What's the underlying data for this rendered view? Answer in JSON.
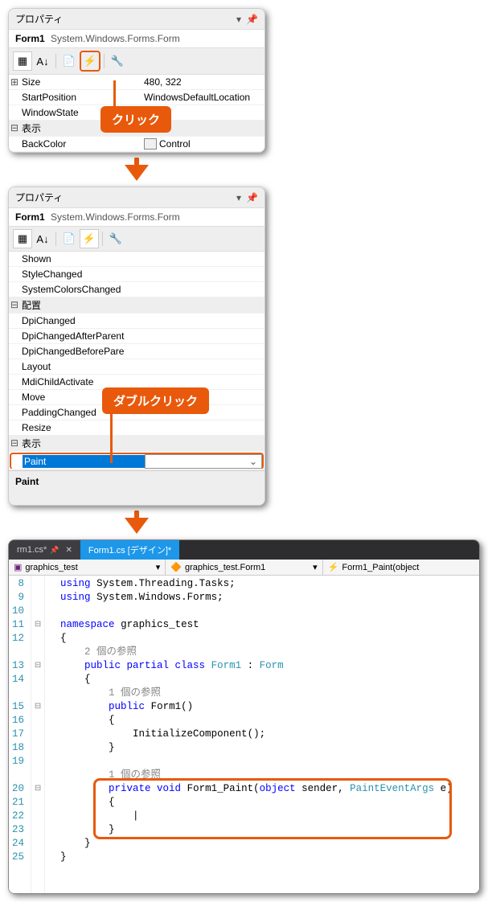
{
  "panel1": {
    "title": "プロパティ",
    "selector_name": "Form1",
    "selector_type": "System.Windows.Forms.Form",
    "rows": [
      {
        "exp": "⊞",
        "name": "Size",
        "val": "480, 322"
      },
      {
        "exp": "",
        "name": "StartPosition",
        "val": "WindowsDefaultLocation"
      },
      {
        "exp": "",
        "name": "WindowState",
        "val": ""
      }
    ],
    "cat": "表示",
    "backcolor_label": "BackColor",
    "backcolor_value": "Control"
  },
  "callout1": "クリック",
  "panel2": {
    "title": "プロパティ",
    "selector_name": "Form1",
    "selector_type": "System.Windows.Forms.Form",
    "events_misc": [
      "Shown",
      "StyleChanged",
      "SystemColorsChanged"
    ],
    "cat1": "配置",
    "events_layout": [
      "DpiChanged",
      "DpiChangedAfterParent",
      "DpiChangedBeforePare",
      "Layout",
      "MdiChildActivate",
      "Move",
      "PaddingChanged",
      "Resize"
    ],
    "cat2": "表示",
    "selected": "Paint",
    "desc": "Paint"
  },
  "callout2": "ダブルクリック",
  "tabs": {
    "t1": "rm1.cs*",
    "t2": "Form1.cs [デザイン]*"
  },
  "nav": {
    "seg1": "graphics_test",
    "seg2": "graphics_test.Form1",
    "seg3": "Form1_Paint(object"
  },
  "code": {
    "lines": [
      8,
      9,
      10,
      11,
      12,
      13,
      14,
      15,
      16,
      17,
      18,
      19,
      20,
      21,
      22,
      23,
      24,
      25
    ],
    "ref1": "2 個の参照",
    "ref2": "1 個の参照",
    "ref3": "1 個の参照",
    "l8_a": "using",
    "l8_b": "System.Threading.Tasks;",
    "l9_a": "using",
    "l9_b": "System.Windows.Forms;",
    "l11_a": "namespace",
    "l11_b": "graphics_test",
    "l12": "{",
    "l13_a": "public partial class",
    "l13_b": "Form1",
    "l13_c": " : ",
    "l13_d": "Form",
    "l14": "{",
    "l15_a": "public",
    "l15_b": "Form1()",
    "l16": "{",
    "l17": "InitializeComponent();",
    "l18": "}",
    "l20_a": "private void",
    "l20_b": "Form1_Paint(",
    "l20_c": "object",
    "l20_d": " sender, ",
    "l20_e": "PaintEventArgs",
    "l20_f": " e)",
    "l21": "{",
    "l22": "",
    "l23": "}",
    "l24": "}",
    "l25": "}"
  }
}
